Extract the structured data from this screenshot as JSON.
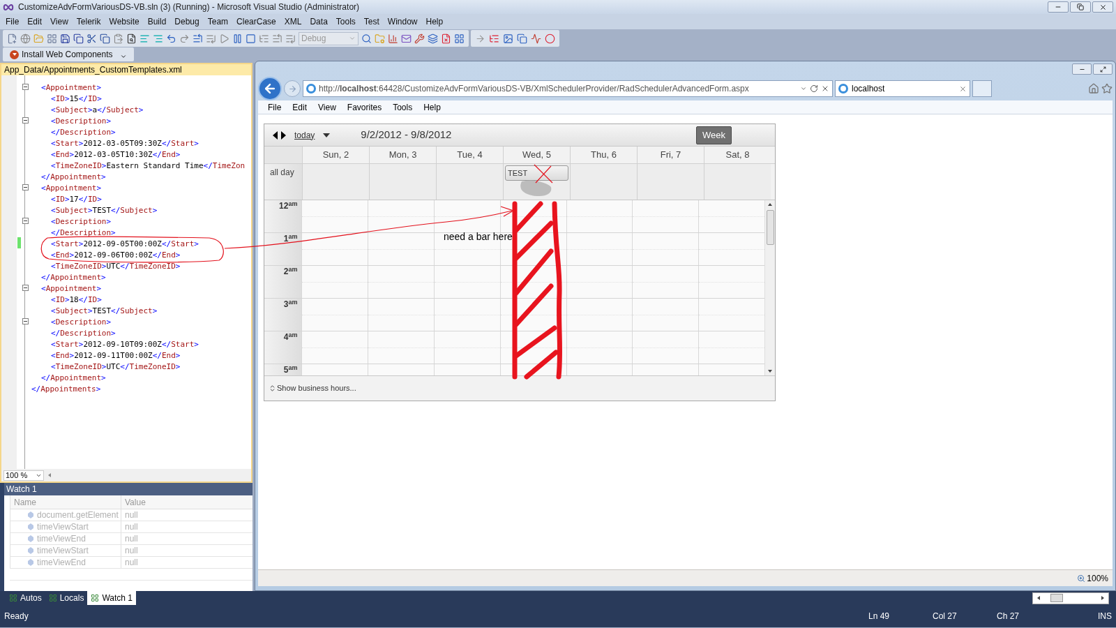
{
  "window": {
    "title": "CustomizeAdvFormVariousDS-VB.sln (3) (Running) - Microsoft Visual Studio (Administrator)"
  },
  "menu": [
    "File",
    "Edit",
    "View",
    "Telerik",
    "Website",
    "Build",
    "Debug",
    "Team",
    "ClearCase",
    "XML",
    "Data",
    "Tools",
    "Test",
    "Window",
    "Help"
  ],
  "toolbar": {
    "configuration": "Debug"
  },
  "web_toolbar": {
    "button": "Install Web Components"
  },
  "editor": {
    "tab": "App_Data/Appointments_CustomTemplates.xml",
    "zoom": "100 %",
    "lines": [
      {
        "children": [
          {
            "text": "<Appointment>",
            "kind": "fold",
            "children": [
              {
                "text": "<ID>15</ID>",
                "kind": "plain"
              },
              {
                "text": "<Subject>a</Subject>",
                "kind": "plain"
              },
              {
                "text": "<Description>",
                "kind": "fold"
              },
              {
                "text": "</Description>",
                "kind": "plain"
              },
              {
                "text": "<Start>2012-03-05T09:30Z</Start>",
                "kind": "plain"
              },
              {
                "text": "<End>2012-03-05T10:30Z</End>",
                "kind": "plain"
              },
              {
                "text": "<TimeZoneID>Eastern Standard Time</TimeZon",
                "kind": "plain"
              }
            ]
          },
          {
            "text": "</Appointment>",
            "kind": "plain"
          },
          {
            "text": "<Appointment>",
            "kind": "fold",
            "children": [
              {
                "text": "<ID>17</ID>",
                "kind": "plain"
              },
              {
                "text": "<Subject>TEST</Subject>",
                "kind": "plain"
              },
              {
                "text": "<Description>",
                "kind": "fold"
              },
              {
                "text": "</Description>",
                "kind": "plain"
              },
              {
                "text": "<Start>2012-09-05T00:00Z</Start>",
                "kind": "changed"
              },
              {
                "text": "<End>2012-09-06T00:00Z</End>",
                "kind": "plain"
              },
              {
                "text": "<TimeZoneID>UTC</TimeZoneID>",
                "kind": "plain"
              }
            ]
          },
          {
            "text": "</Appointment>",
            "kind": "plain"
          },
          {
            "text": "<Appointment>",
            "kind": "fold",
            "children": [
              {
                "text": "<ID>18</ID>",
                "kind": "plain"
              },
              {
                "text": "<Subject>TEST</Subject>",
                "kind": "plain"
              },
              {
                "text": "<Description>",
                "kind": "fold"
              },
              {
                "text": "</Description>",
                "kind": "plain"
              },
              {
                "text": "<Start>2012-09-10T09:00Z</Start>",
                "kind": "plain"
              },
              {
                "text": "<End>2012-09-11T00:00Z</End>",
                "kind": "plain"
              },
              {
                "text": "<TimeZoneID>UTC</TimeZoneID>",
                "kind": "plain"
              }
            ]
          },
          {
            "text": "</Appointment>",
            "kind": "plain"
          }
        ]
      },
      {
        "text": "</Appointments>",
        "kind": "plain"
      }
    ]
  },
  "watch": {
    "title": "Watch 1",
    "columns": [
      "Name",
      "Value"
    ],
    "rows": [
      {
        "name": "document.getElement",
        "value": "null",
        "disabled": true
      },
      {
        "name": "timeViewStart",
        "value": "null",
        "disabled": true
      },
      {
        "name": "timeViewEnd",
        "value": "null",
        "disabled": true
      },
      {
        "name": "timeViewStart",
        "value": "null",
        "disabled": true
      },
      {
        "name": "timeViewEnd",
        "value": "null",
        "disabled": true
      }
    ]
  },
  "bottom_tabs": [
    {
      "label": "Autos",
      "selected": false
    },
    {
      "label": "Locals",
      "selected": false
    },
    {
      "label": "Watch 1",
      "selected": true
    }
  ],
  "status_bar": {
    "text": "Ready",
    "line": "Ln 49",
    "col": "Col 27",
    "ch": "Ch 27",
    "mode": "INS"
  },
  "browser": {
    "url": "http://**localhost**:64428/CustomizeAdvFormVariousDS-VB/XmlSchedulerProvider/RadSchedulerAdvancedForm.aspx",
    "tab": "localhost",
    "menu": [
      "File",
      "Edit",
      "View",
      "Favorites",
      "Tools",
      "Help"
    ],
    "zoom": "100%"
  },
  "scheduler": {
    "today": "today",
    "range": "9/2/2012 - 9/8/2012",
    "views": [
      {
        "label": "Week",
        "selected": true
      }
    ],
    "all_day_label": "all day",
    "days": [
      {
        "label": "Sun, 2"
      },
      {
        "label": "Mon, 3"
      },
      {
        "label": "Tue, 4"
      },
      {
        "label": "Wed, 5",
        "all_day": "TEST"
      },
      {
        "label": "Thu, 6"
      },
      {
        "label": "Fri, 7"
      },
      {
        "label": "Sat, 8"
      }
    ],
    "hours": [
      "12$^{am}$",
      "1$^{am}$",
      "2$^{am}$",
      "3$^{am}$",
      "4$^{am}$",
      "5$^{am}$"
    ],
    "footer": "Show business hours..."
  },
  "annotation": {
    "note": "need a bar here"
  }
}
